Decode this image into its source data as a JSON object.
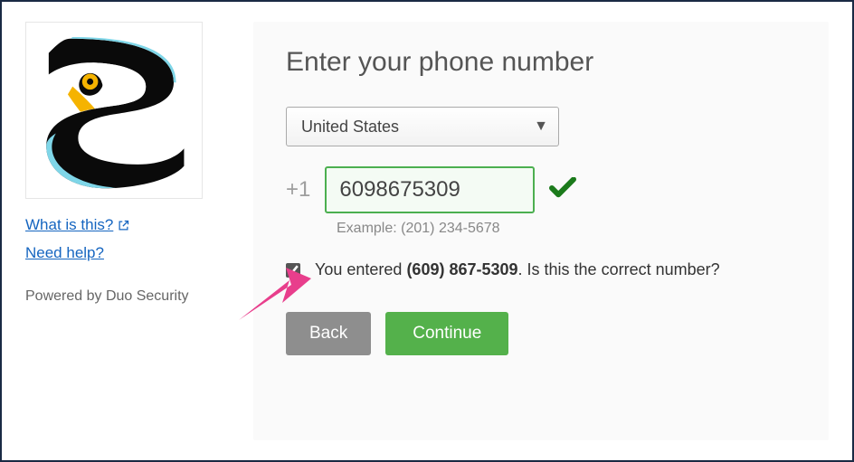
{
  "sidebar": {
    "what_link": "What is this?",
    "help_link": "Need help?",
    "powered_by": "Powered by Duo Security"
  },
  "main": {
    "heading": "Enter your phone number",
    "country_selected": "United States",
    "dial_prefix": "+1",
    "phone_value": "6098675309",
    "example_text": "Example: (201) 234-5678",
    "confirm_prefix": "You entered ",
    "confirm_number": "(609) 867-5309",
    "confirm_suffix": ". Is this the correct number?",
    "back_label": "Back",
    "continue_label": "Continue"
  },
  "colors": {
    "outer_border": "#1a2a44",
    "link": "#1565c0",
    "input_valid_border": "#4caf50",
    "checkmark": "#2e7d32",
    "continue_bg": "#54b14b",
    "back_bg": "#8e8e8e",
    "annotation_arrow": "#e83e8c"
  }
}
